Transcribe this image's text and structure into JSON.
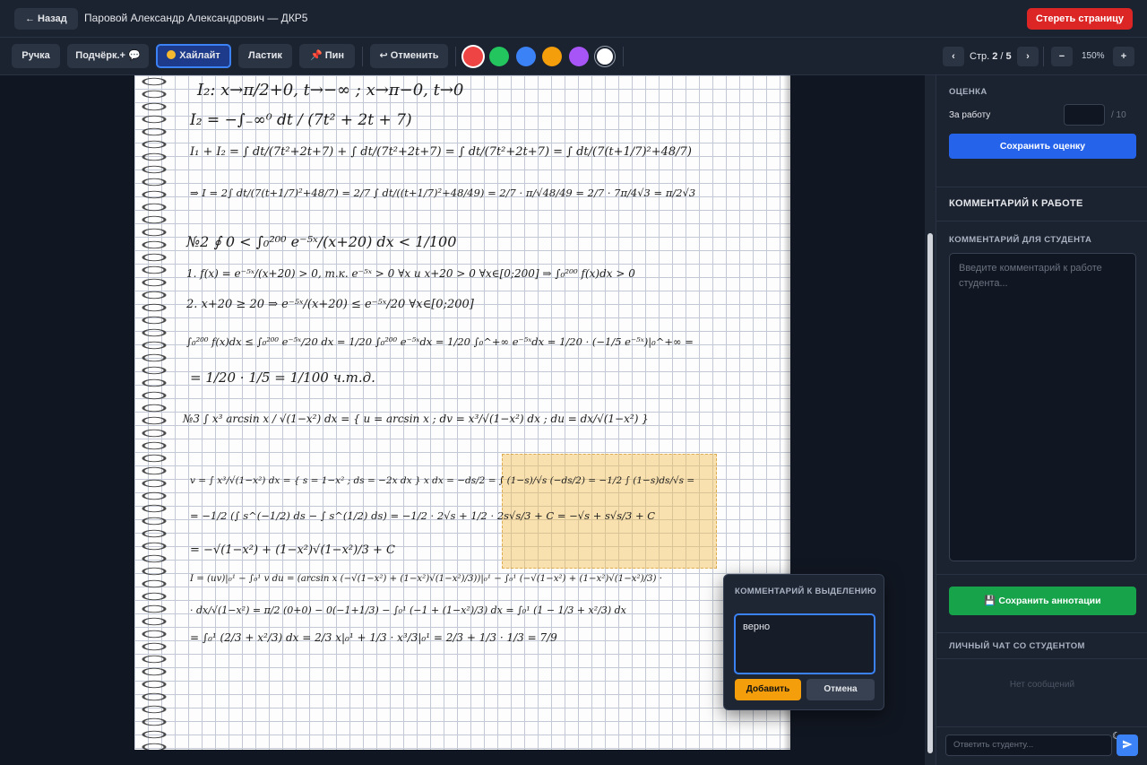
{
  "header": {
    "back_label": "← Назад",
    "title": "Паровой Александр Александрович — ДКР5",
    "erase_label": "Стереть страницу"
  },
  "toolbar": {
    "tools": [
      "Ручка",
      "Подчёрк.+ 💬",
      "Хайлайт",
      "Ластик",
      "📌 Пин"
    ],
    "active_tool": "Хайлайт",
    "undo_label": "↩ Отменить",
    "colors": [
      "#ef4444",
      "#22c55e",
      "#3b82f6",
      "#f59e0b",
      "#a855f7",
      "#ffffff"
    ],
    "selected_color": "#ef4444",
    "page_prefix": "Стр. ",
    "page_current": "2",
    "page_total": "5",
    "page_sep": " / ",
    "prev_label": "‹",
    "next_label": "›",
    "zoom_out": "−",
    "zoom_in": "+",
    "zoom": "150%"
  },
  "document": {
    "lines": [
      "I₂: x→π/2+0, t→−∞ ; x→π−0, t→0",
      "I₂ = −∫₋∞⁰ dt / (7t² + 2t + 7)",
      "I₁ + I₂ = ∫ dt/(7t²+2t+7) + ∫ dt/(7t²+2t+7) = ∫ dt/(7t²+2t+7) = ∫ dt/(7(t+1/7)²+48/7)",
      "⇒ I = 2∫ dt/(7(t+1/7)²+48/7) = 2/7 ∫ dt/((t+1/7)²+48/49) = 2/7 · π/√48/49 = 2/7 · 7π/4√3 = π/2√3",
      "№2  ∮ 0 < ∫₀²⁰⁰ e⁻⁵ˣ/(x+20) dx < 1/100",
      "1. f(x) = e⁻⁵ˣ/(x+20) > 0, т.к. e⁻⁵ˣ > 0 ∀x и x+20 > 0 ∀x∈[0;200] ⇒ ∫₀²⁰⁰ f(x)dx > 0",
      "2. x+20 ≥ 20 ⇒ e⁻⁵ˣ/(x+20) ≤ e⁻⁵ˣ/20  ∀x∈[0;200]",
      "∫₀²⁰⁰ f(x)dx ≤ ∫₀²⁰⁰ e⁻⁵ˣ/20 dx = 1/20 ∫₀²⁰⁰ e⁻⁵ˣdx = 1/20 ∫₀^+∞ e⁻⁵ˣdx = 1/20 · (−1/5 e⁻⁵ˣ)|₀^+∞ =",
      "= 1/20 · 1/5 = 1/100       ч.т.д.",
      "№3  ∫ x³ arcsin x / √(1−x²) dx = { u = arcsin x ; dv = x³/√(1−x²) dx ; du = dx/√(1−x²) }",
      "v = ∫ x³/√(1−x²) dx = { s = 1−x² ; ds = −2x dx }  x dx = −ds/2  = ∫ (1−s)/√s (−ds/2) = −1/2 ∫ (1−s)ds/√s =",
      "= −1/2 (∫ s^(−1/2) ds − ∫ s^(1/2) ds) = −1/2 · 2√s + 1/2 · 2s√s/3 + C = −√s + s√s/3 + C",
      "= −√(1−x²) + (1−x²)√(1−x²)/3 + C",
      "I = (uv)|₀¹ − ∫₀¹ v du = (arcsin x (−√(1−x²) + (1−x²)√(1−x²)/3))|₀¹ − ∫₀¹ (−√(1−x²) + (1−x²)√(1−x²)/3) ·",
      "· dx/√(1−x²) = π/2 (0+0) − 0(−1+1/3) − ∫₀¹ (−1 + (1−x²)/3) dx = ∫₀¹ (1 − 1/3 + x²/3) dx",
      "= ∫₀¹ (2/3 + x²/3) dx = 2/3 x|₀¹ + 1/3 · x³/3|₀¹ = 2/3 + 1/3 · 1/3 = 7/9"
    ]
  },
  "popup": {
    "title": "КОММЕНТАРИЙ К ВЫДЕЛЕНИЮ",
    "text": "верно",
    "add_label": "Добавить",
    "cancel_label": "Отмена"
  },
  "panel": {
    "grade_label": "ОЦЕНКА",
    "score_label": "За работу",
    "score_value": "",
    "score_max": "/ 10",
    "save_score_label": "Сохранить оценку",
    "comment_heading": "КОММЕНТАРИЙ К РАБОТЕ",
    "student_comment_label": "КОММЕНТАРИЙ ДЛЯ СТУДЕНТА",
    "comment_placeholder": "Введите комментарий к работе студента...",
    "save_annotations_label": "💾 Сохранить аннотации",
    "chat_label": "ЛИЧНЫЙ ЧАТ СО СТУДЕНТОМ",
    "no_messages": "Нет сообщений",
    "reply_placeholder": "Ответить студенту...",
    "send_icon": "send-icon",
    "theme_icon": "moon-icon"
  }
}
